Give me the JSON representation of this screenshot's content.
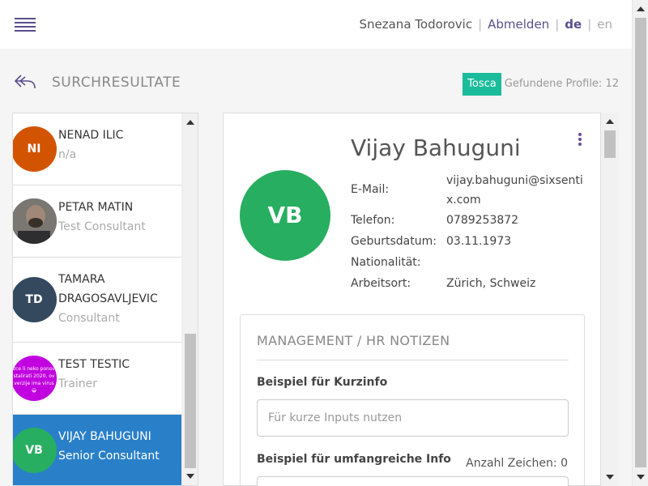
{
  "header": {
    "user_name": "Snezana Todorovic",
    "logout_label": "Abmelden",
    "lang_active": "de",
    "lang_other": "en",
    "separator": "|"
  },
  "page": {
    "title": "SURCHRESULTATE",
    "badge": "Tosca",
    "count_text": "Gefundene Profile: 12"
  },
  "results": [
    {
      "initials": "NI",
      "name": "NENAD ILIC",
      "role": "n/a",
      "color": "#d35400"
    },
    {
      "initials": "",
      "name": "PETAR MATIN",
      "role": "Test Consultant",
      "color": "#6b6b6b",
      "photo": true
    },
    {
      "initials": "TD",
      "name_line1": "TAMARA",
      "name_line2": "DRAGOSAVLJEVIC",
      "role": "Consultant",
      "color": "#34495e"
    },
    {
      "initials": "",
      "name": "TEST TESTIC",
      "role": "Trainer",
      "color": "#c100e0",
      "avatar_text": "zce li neko ponov stalirati 2020, ov verzije ima virus 😀"
    },
    {
      "initials": "VB",
      "name": "VIJAY BAHUGUNI",
      "role": "Senior Consultant",
      "color": "#27ae60",
      "active": true
    }
  ],
  "profile": {
    "initials": "VB",
    "name": "Vijay Bahuguni",
    "email_label": "E-Mail:",
    "email_line1": "vijay.bahuguni@sixsenti",
    "email_line2": "x.com",
    "phone_label": "Telefon:",
    "phone": "0789253872",
    "birth_label": "Geburtsdatum:",
    "birth": "03.11.1973",
    "nationality_label": "Nationalität:",
    "nationality": "",
    "location_label": "Arbeitsort:",
    "location": "Zürich, Schweiz"
  },
  "notes": {
    "title": "MANAGEMENT / HR NOTIZEN",
    "short_label": "Beispiel für Kurzinfo",
    "short_placeholder": "Für kurze Inputs nutzen",
    "long_label": "Beispiel für umfangreiche Info",
    "char_count": "Anzahl Zeichen: 0"
  },
  "colors": {
    "accent": "#5a4e8c",
    "badge": "#1abc9c",
    "active_row": "#2980c9"
  }
}
